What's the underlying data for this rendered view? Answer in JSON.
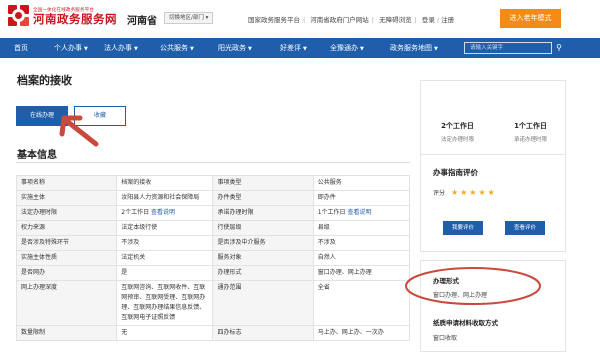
{
  "header": {
    "logo_sub": "全国一体化在线政务服务平台",
    "logo_main": "河南政务服务网",
    "region": "河南省",
    "region_select": "切换地区/部门 ▾",
    "links": [
      "国家政务服务平台",
      "河南省政府门户网站",
      "无障碍浏览",
      "登录",
      "注册"
    ],
    "elder_button": "进入老年模式",
    "brand_color": "#c8161d",
    "accent_color": "#f28b17"
  },
  "nav": {
    "items": [
      "首页",
      "个人办事",
      "法人办事",
      "公共服务",
      "阳光政务",
      "好差评",
      "全豫通办",
      "政务服务地图"
    ],
    "search_placeholder": "请输入关键字",
    "search_icon": "search-icon",
    "nav_color": "#1e5eab"
  },
  "page": {
    "title": "档案的接收",
    "online_button": "在线办理",
    "collect_button": "收藏",
    "section_title": "基本信息",
    "query_link": "查看说明"
  },
  "table": {
    "rows": [
      {
        "l1": "事项名称",
        "v1": "档案的接收",
        "l2": "事项类型",
        "v2": "公共服务"
      },
      {
        "l1": "实施主体",
        "v1": "汝阳县人力资源和社会保障局",
        "l2": "办件类型",
        "v2": "即办件"
      },
      {
        "l1": "法定办理时限",
        "v1": "2个工作日",
        "l2": "承诺办理时限",
        "v2": "1个工作日"
      },
      {
        "l1": "权力来源",
        "v1": "法定本级行使",
        "l2": "行使层级",
        "v2": "县级"
      },
      {
        "l1": "是否涉及特殊环节",
        "v1": "不涉及",
        "l2": "是否涉及中介服务",
        "v2": "不涉及"
      },
      {
        "l1": "实施主体性质",
        "v1": "法定机关",
        "l2": "服务对象",
        "v2": "自然人"
      },
      {
        "l1": "是否网办",
        "v1": "是",
        "l2": "办理形式",
        "v2": "窗口办理、网上办理"
      },
      {
        "l1": "网上办理深度",
        "v1": "互联网咨询、互联网收件、互联网预审、互联网受理、互联网办理、互联网办理结果信息反馈、互联网电子证照反馈",
        "l2": "通办范围",
        "v2": "全省"
      },
      {
        "l1": "数量限制",
        "v1": "无",
        "l2": "四办标志",
        "v2": "马上办、网上办、一次办"
      }
    ]
  },
  "sidebar": {
    "legal_days": "2个工作日",
    "legal_caption": "法定办理时限",
    "promise_days": "1个工作日",
    "promise_caption": "承诺办理时限",
    "eval_title": "办事指南评价",
    "rating_label": "评分",
    "stars": "★★★★★",
    "eval_button": "我要评价",
    "view_eval_button": "查看评价",
    "mode_title": "办理形式",
    "mode_value": "窗口办理、网上办理",
    "paper_title": "纸质申请材料收取方式",
    "paper_value": "窗口收取"
  }
}
